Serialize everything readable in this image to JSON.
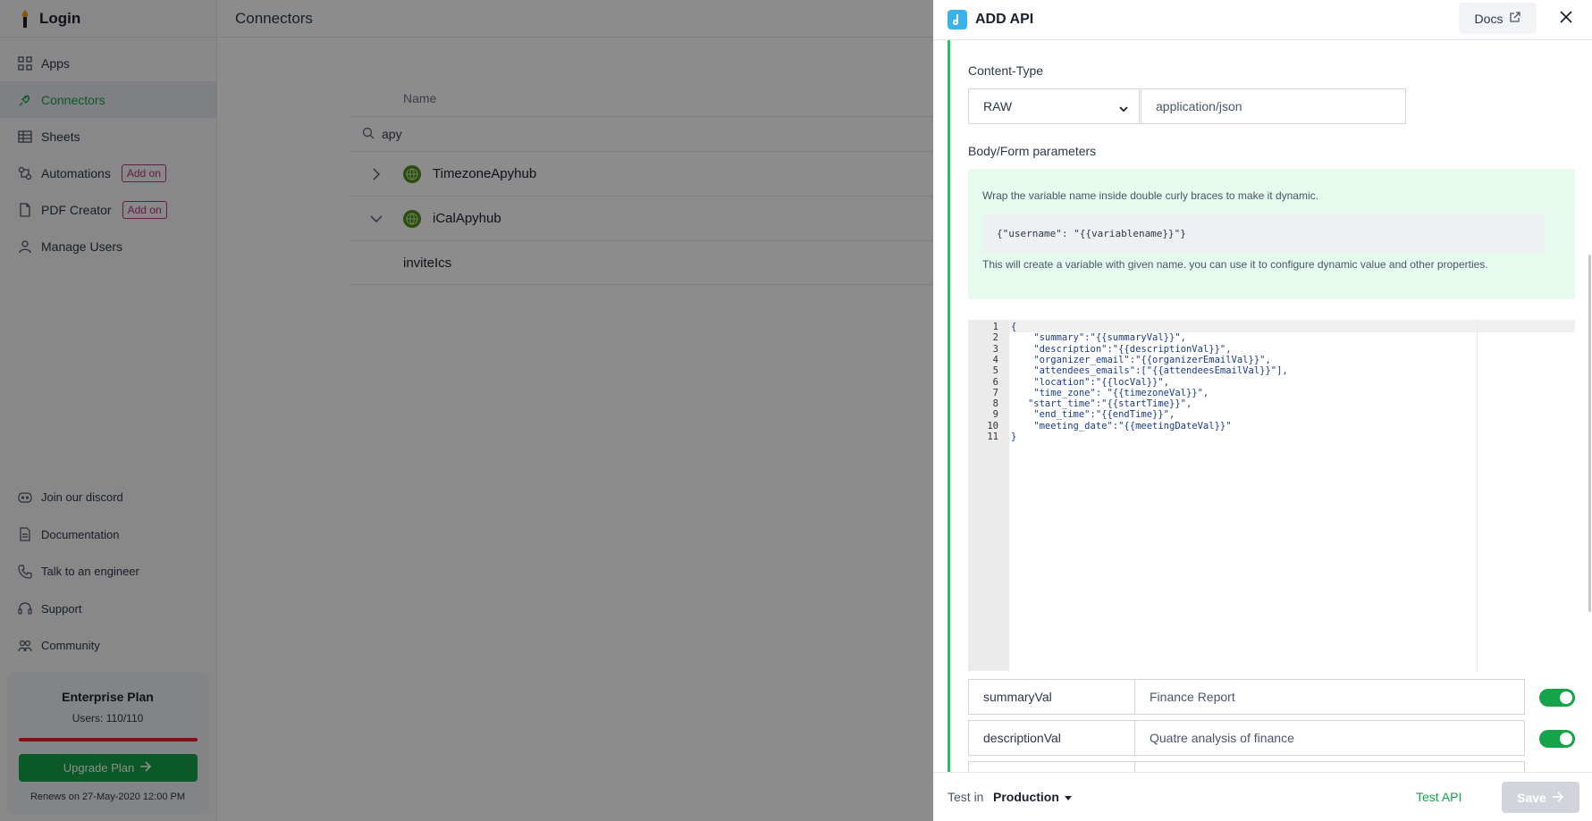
{
  "app": {
    "brand": "Login",
    "page_title": "Connectors"
  },
  "sidebar": {
    "items": [
      {
        "label": "Apps",
        "icon": "apps-icon"
      },
      {
        "label": "Connectors",
        "icon": "plug-icon",
        "active": true
      },
      {
        "label": "Sheets",
        "icon": "table-icon"
      },
      {
        "label": "Automations",
        "icon": "automation-icon",
        "badge": "Add on"
      },
      {
        "label": "PDF Creator",
        "icon": "document-icon",
        "badge": "Add on"
      },
      {
        "label": "Manage Users",
        "icon": "user-icon"
      }
    ],
    "bottom_items": [
      {
        "label": "Join our discord",
        "icon": "discord-icon"
      },
      {
        "label": "Documentation",
        "icon": "docs-icon"
      },
      {
        "label": "Talk to an engineer",
        "icon": "phone-icon"
      },
      {
        "label": "Support",
        "icon": "headset-icon"
      },
      {
        "label": "Community",
        "icon": "community-icon"
      }
    ],
    "plan": {
      "name": "Enterprise Plan",
      "users": "Users: 110/110",
      "usage_fraction": 1.0,
      "upgrade_label": "Upgrade Plan",
      "renews": "Renews on 27-May-2020 12:00 PM"
    }
  },
  "connectors_table": {
    "column_name": "Name",
    "search_value": "apy",
    "rows": [
      {
        "name": "TimezoneApyhub",
        "expanded": false
      },
      {
        "name": "iCalApyhub",
        "expanded": true
      }
    ],
    "sub_row": "inviteIcs"
  },
  "drawer": {
    "title": "ADD API",
    "docs_label": "Docs",
    "content_type_label": "Content-Type",
    "content_type_select": "RAW",
    "content_type_value": "application/json",
    "body_params_label": "Body/Form parameters",
    "info_line1": "Wrap the variable name inside double curly braces to make it dynamic.",
    "info_code": "{\"username\": \"{{variablename}}\"}",
    "info_line2": "This will create a variable with given name. you can use it to configure dynamic value and other properties.",
    "code_lines": [
      "{",
      "    \"summary\":\"{{summaryVal}}\",",
      "    \"description\":\"{{descriptionVal}}\",",
      "    \"organizer_email\":\"{{organizerEmailVal}}\",",
      "    \"attendees_emails\":[\"{{attendeesEmailVal}}\"],",
      "    \"location\":\"{{locVal}}\",",
      "    \"time_zone\": \"{{timezoneVal}}\",",
      "   \"start_time\":\"{{startTime}}\",",
      "    \"end_time\":\"{{endTime}}\",",
      "    \"meeting_date\":\"{{meetingDateVal}}\"",
      "}"
    ],
    "params": [
      {
        "key": "summaryVal",
        "value": "Finance Report",
        "enabled": true
      },
      {
        "key": "descriptionVal",
        "value": "Quatre analysis of finance",
        "enabled": true
      }
    ],
    "footer": {
      "test_in_label": "Test in",
      "environment": "Production",
      "test_api_label": "Test API",
      "save_label": "Save"
    }
  },
  "colors": {
    "accent_green": "#16a34a",
    "addon_badge": "#b83280",
    "api_icon": "#3bb3e8",
    "info_bg": "#e6fbee"
  }
}
